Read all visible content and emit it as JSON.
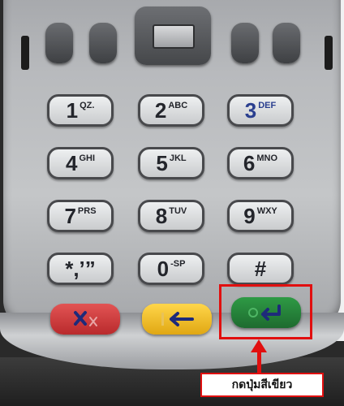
{
  "keypad": {
    "rows": [
      [
        {
          "main": "1",
          "sub": "QZ."
        },
        {
          "main": "2",
          "sub": "ABC"
        },
        {
          "main": "3",
          "sub": "DEF",
          "blue": true
        }
      ],
      [
        {
          "main": "4",
          "sub": "GHI"
        },
        {
          "main": "5",
          "sub": "JKL"
        },
        {
          "main": "6",
          "sub": "MNO"
        }
      ],
      [
        {
          "main": "7",
          "sub": "PRS"
        },
        {
          "main": "8",
          "sub": "TUV"
        },
        {
          "main": "9",
          "sub": "WXY"
        }
      ],
      [
        {
          "main": "*,’”",
          "sub": ""
        },
        {
          "main": "0",
          "sub": "-SP"
        },
        {
          "main": "#",
          "sub": ""
        }
      ]
    ],
    "function_keys": [
      {
        "name": "cancel",
        "color": "#c93436",
        "icon": "x-icon"
      },
      {
        "name": "backspace",
        "color": "#f2c12a",
        "icon": "back-arrow-icon"
      },
      {
        "name": "enter",
        "color": "#268a3b",
        "icon": "enter-icon"
      }
    ]
  },
  "callout": {
    "caption": "กดปุ่มสีเขียว",
    "color": "#e10f0f"
  }
}
